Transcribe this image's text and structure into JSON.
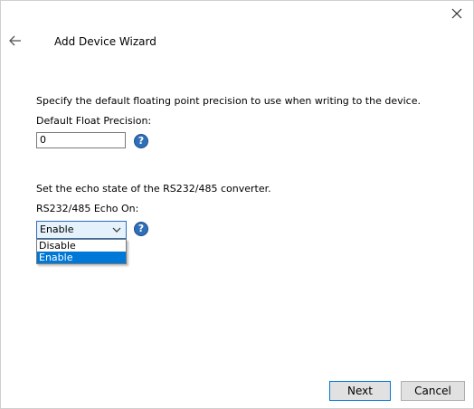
{
  "window": {
    "title": "Add Device Wizard"
  },
  "icons": {
    "close": "close-icon",
    "back": "back-arrow-icon",
    "help": "help-icon",
    "chevron": "chevron-down-icon"
  },
  "precision": {
    "description": "Specify the default floating point precision to use when writing to the device.",
    "label": "Default Float Precision:",
    "value": "0"
  },
  "echo": {
    "description": "Set the echo state of the RS232/485 converter.",
    "label": "RS232/485 Echo On:",
    "selected": "Enable",
    "options": [
      "Disable",
      "Enable"
    ]
  },
  "help_glyph": "?",
  "buttons": {
    "next": "Next",
    "cancel": "Cancel"
  },
  "colors": {
    "accent": "#0078d7",
    "help": "#2f6fb7",
    "select_bg": "#e5f1fb"
  }
}
